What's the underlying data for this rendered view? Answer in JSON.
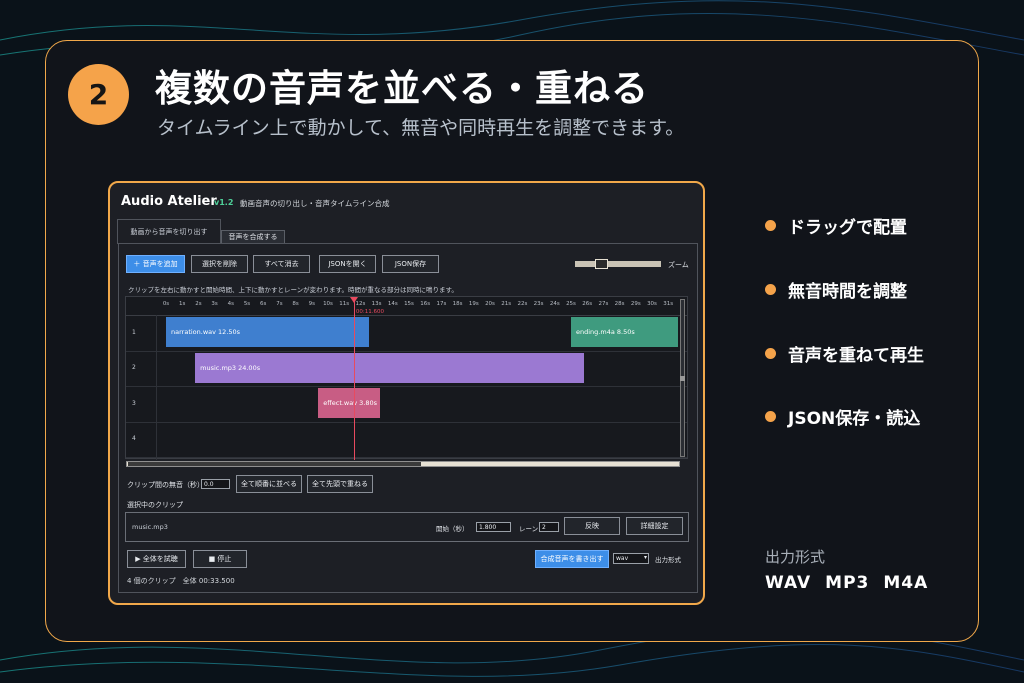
{
  "slide": {
    "step_number": "2",
    "title": "複数の音声を並べる・重ねる",
    "subtitle": "タイムライン上で動かして、無音や同時再生を調整できます。"
  },
  "app": {
    "name": "Audio Atelier",
    "version": "v1.2",
    "description": "動画音声の切り出し・音声タイムライン合成",
    "tabs": [
      {
        "label": "動画から音声を切り出す",
        "active": false
      },
      {
        "label": "音声を合成する",
        "active": true
      }
    ],
    "toolbar": {
      "add_audio": "＋ 音声を追加",
      "delete_selected": "選択を削除",
      "clear_all": "すべて消去",
      "open_json": "JSONを開く",
      "save_json": "JSON保存",
      "zoom_label": "ズーム"
    },
    "hint": "クリップを左右に動かすと開始時間、上下に動かすとレーンが変わります。時間が重なる部分は同時に鳴ります。",
    "timeline": {
      "ticks": [
        "0s",
        "1s",
        "2s",
        "3s",
        "4s",
        "5s",
        "6s",
        "7s",
        "8s",
        "9s",
        "10s",
        "11s",
        "12s",
        "13s",
        "14s",
        "15s",
        "16s",
        "17s",
        "18s",
        "19s",
        "20s",
        "21s",
        "22s",
        "23s",
        "24s",
        "25s",
        "26s",
        "27s",
        "28s",
        "29s",
        "30s",
        "31s"
      ],
      "playhead_time": "00:11.600",
      "playhead_seconds": 11.6,
      "lanes": [
        "1",
        "2",
        "3",
        "4"
      ],
      "clips": [
        {
          "label": "narration.wav  12.50s",
          "lane": 1,
          "start": 0,
          "duration": 12.5,
          "color": "#3f7fcf"
        },
        {
          "label": "music.mp3  24.00s",
          "lane": 2,
          "start": 1.8,
          "duration": 24.0,
          "color": "#9b79d2"
        },
        {
          "label": "effect.wav  3.80s",
          "lane": 3,
          "start": 9.4,
          "duration": 3.8,
          "color": "#c85d84"
        },
        {
          "label": "ending.m4a  8.50s",
          "lane": 1,
          "start": 25,
          "duration": 6.6,
          "color": "#3f9b7f"
        }
      ]
    },
    "gap": {
      "label": "クリップ間の無音（秒）",
      "value": "0.0",
      "arrange_button": "全て順番に並べる",
      "overlap_button": "全て先頭で重ねる"
    },
    "selected": {
      "heading": "選択中のクリップ",
      "name": "music.mp3",
      "start_label": "開始（秒）",
      "start_value": "1.800",
      "lane_label": "レーン",
      "lane_value": "2",
      "reverse_button": "反映",
      "details_button": "詳細設定"
    },
    "playback": {
      "play_all": "▶ 全体を試聴",
      "stop": "■ 停止",
      "export_button": "合成音声を書き出す",
      "format_value": "wav",
      "format_label": "出力形式"
    },
    "status": "4 個のクリップ　全体 00:33.500"
  },
  "features": [
    "ドラッグで配置",
    "無音時間を調整",
    "音声を重ねて再生",
    "JSON保存・読込"
  ],
  "output": {
    "label": "出力形式",
    "formats": [
      "WAV",
      "MP3",
      "M4A"
    ]
  },
  "colors": {
    "accent": "#f5a34a",
    "primary_button": "#3d8ee8",
    "playhead": "#e84a5f"
  }
}
